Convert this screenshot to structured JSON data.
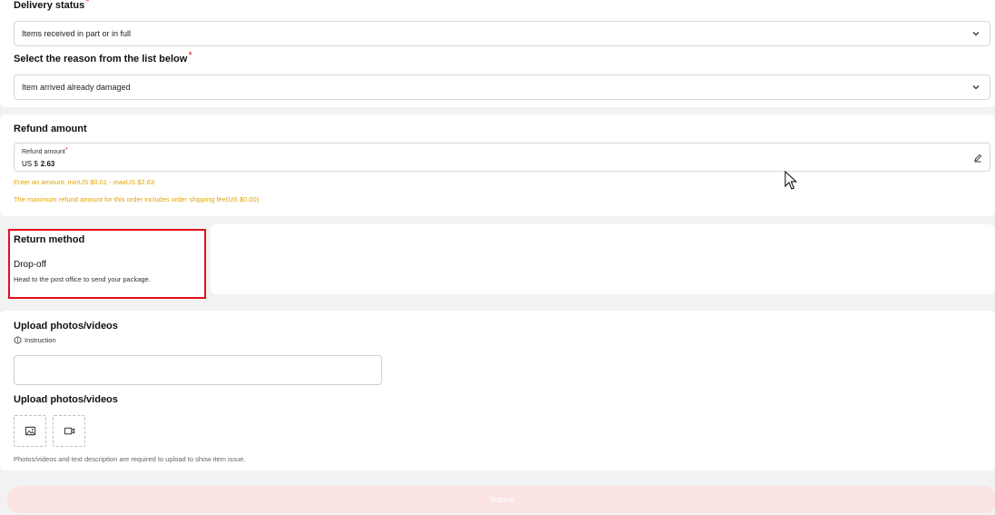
{
  "delivery": {
    "status_label": "Delivery status",
    "status_value": "Items received in part or in full",
    "reason_label": "Select the reason from the list below",
    "reason_value": "Item arrived already damaged",
    "required_mark": "*"
  },
  "refund": {
    "title": "Refund amount",
    "field_label": "Refund amount",
    "currency": "US $",
    "amount": "2.63",
    "hint_range": "Enter an amount: minUS $0.01 - maxUS $2.63",
    "hint_max": "The maximum refund amount for this order includes order shipping fee(US $0.00)"
  },
  "return_method": {
    "title": "Return method",
    "option": "Drop-off",
    "description": "Head to the post office to send your package."
  },
  "upload": {
    "title": "Upload photos/videos",
    "instruction": "Instruction",
    "title2": "Upload photos/videos",
    "footnote": "Photos/videos and text description are required to upload to show item issue."
  },
  "submit": {
    "label": "Submit"
  },
  "colors": {
    "accent": "#e2101a",
    "warning": "#e3a400",
    "submit_bg": "#fbe3e4"
  },
  "icons": {
    "select": "chevron-down-icon",
    "edit": "pencil-icon",
    "photo": "image-icon",
    "video": "video-icon",
    "info": "hexagon-info-icon",
    "cursor": "mouse-cursor-icon"
  }
}
